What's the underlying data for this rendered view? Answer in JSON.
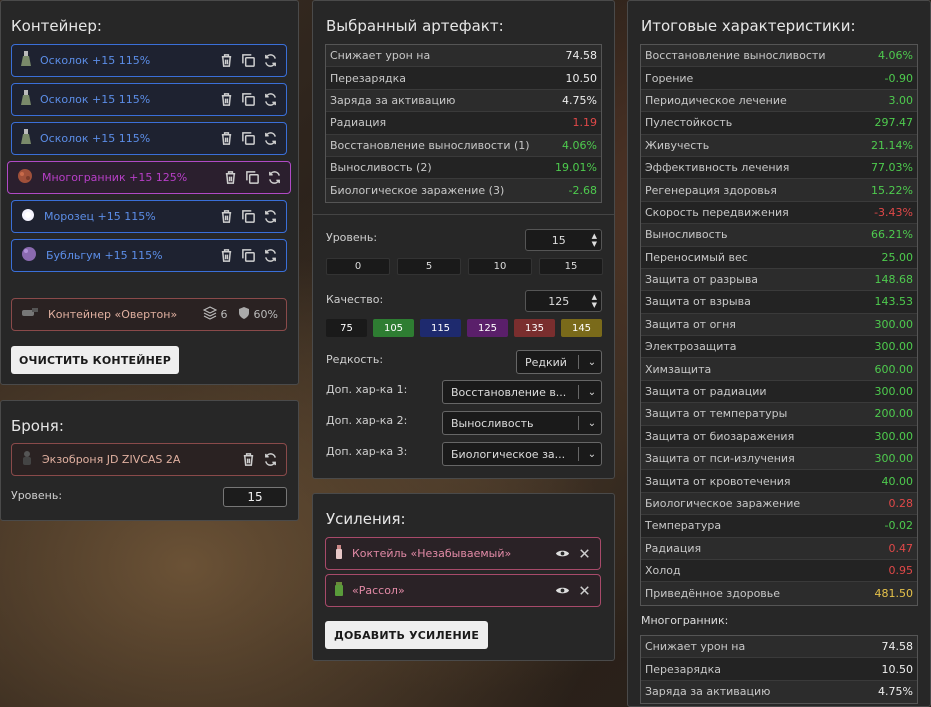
{
  "container": {
    "title": "Контейнер:",
    "items": [
      {
        "label": "Осколок +15 115%",
        "icon": "flask-icon"
      },
      {
        "label": "Осколок +15 115%",
        "icon": "flask-icon"
      },
      {
        "label": "Осколок +15 115%",
        "icon": "flask-icon"
      },
      {
        "label": "Многогранник +15 125%",
        "icon": "polyhedron-icon"
      },
      {
        "label": "Морозец +15 115%",
        "icon": "frost-icon"
      },
      {
        "label": "Бубльгум +15 115%",
        "icon": "bubblegum-icon"
      }
    ],
    "container_item": {
      "label": "Контейнер «Овертон»",
      "slots": "6",
      "protection": "60%"
    },
    "clear_button": "ОЧИСТИТЬ КОНТЕЙНЕР"
  },
  "armor": {
    "title": "Броня:",
    "item": "Экзоброня JD ZIVCAS 2A",
    "level_label": "Уровень:",
    "level_value": "15"
  },
  "artifact": {
    "title": "Выбранный артефакт:",
    "stats": [
      {
        "k": "Снижает урон на",
        "v": "74.58",
        "c": "white"
      },
      {
        "k": "Перезарядка",
        "v": "10.50",
        "c": "white"
      },
      {
        "k": "Заряда за активацию",
        "v": "4.75%",
        "c": "white"
      },
      {
        "k": "Радиация",
        "v": "1.19",
        "c": "red"
      },
      {
        "k": "Восстановление выносливости (1)",
        "v": "4.06%",
        "c": "green"
      },
      {
        "k": "Выносливость (2)",
        "v": "19.01%",
        "c": "green"
      },
      {
        "k": "Биологическое заражение (3)",
        "v": "-2.68",
        "c": "green"
      }
    ],
    "level_label": "Уровень:",
    "level_value": "15",
    "level_buttons": [
      "0",
      "5",
      "10",
      "15"
    ],
    "quality_label": "Качество:",
    "quality_value": "125",
    "quality_buttons": [
      {
        "label": "75",
        "color": "#1a1a1a"
      },
      {
        "label": "105",
        "color": "#2e7d32"
      },
      {
        "label": "115",
        "color": "#1e2a6e"
      },
      {
        "label": "125",
        "color": "#5a1f6a"
      },
      {
        "label": "135",
        "color": "#7a2e2e"
      },
      {
        "label": "145",
        "color": "#7a6a1a"
      }
    ],
    "rarity_label": "Редкость:",
    "rarity_value": "Редкий",
    "extra1_label": "Доп. хар-ка 1:",
    "extra1_value": "Восстановление в...",
    "extra2_label": "Доп. хар-ка 2:",
    "extra2_value": "Выносливость",
    "extra3_label": "Доп. хар-ка 3:",
    "extra3_value": "Биологическое за..."
  },
  "boosts": {
    "title": "Усиления:",
    "items": [
      {
        "label": "Коктейль «Незабываемый»"
      },
      {
        "label": "«Рассол»"
      }
    ],
    "add_button": "ДОБАВИТЬ УСИЛЕНИЕ"
  },
  "totals": {
    "title": "Итоговые характеристики:",
    "stats": [
      {
        "k": "Восстановление выносливости",
        "v": "4.06%",
        "c": "green"
      },
      {
        "k": "Горение",
        "v": "-0.90",
        "c": "green"
      },
      {
        "k": "Периодическое лечение",
        "v": "3.00",
        "c": "green"
      },
      {
        "k": "Пулестойкость",
        "v": "297.47",
        "c": "green"
      },
      {
        "k": "Живучесть",
        "v": "21.14%",
        "c": "green"
      },
      {
        "k": "Эффективность лечения",
        "v": "77.03%",
        "c": "green"
      },
      {
        "k": "Регенерация здоровья",
        "v": "15.22%",
        "c": "green"
      },
      {
        "k": "Скорость передвижения",
        "v": "-3.43%",
        "c": "red"
      },
      {
        "k": "Выносливость",
        "v": "66.21%",
        "c": "green"
      },
      {
        "k": "Переносимый вес",
        "v": "25.00",
        "c": "green"
      },
      {
        "k": "Защита от разрыва",
        "v": "148.68",
        "c": "green"
      },
      {
        "k": "Защита от взрыва",
        "v": "143.53",
        "c": "green"
      },
      {
        "k": "Защита от огня",
        "v": "300.00",
        "c": "green"
      },
      {
        "k": "Электрозащита",
        "v": "300.00",
        "c": "green"
      },
      {
        "k": "Химзащита",
        "v": "600.00",
        "c": "green"
      },
      {
        "k": "Защита от радиации",
        "v": "300.00",
        "c": "green"
      },
      {
        "k": "Защита от температуры",
        "v": "200.00",
        "c": "green"
      },
      {
        "k": "Защита от биозаражения",
        "v": "300.00",
        "c": "green"
      },
      {
        "k": "Защита от пси-излучения",
        "v": "300.00",
        "c": "green"
      },
      {
        "k": "Защита от кровотечения",
        "v": "40.00",
        "c": "green"
      },
      {
        "k": "Биологическое заражение",
        "v": "0.28",
        "c": "red"
      },
      {
        "k": "Температура",
        "v": "-0.02",
        "c": "green"
      },
      {
        "k": "Радиация",
        "v": "0.47",
        "c": "red"
      },
      {
        "k": "Холод",
        "v": "0.95",
        "c": "red"
      },
      {
        "k": "Приведённое здоровье",
        "v": "481.50",
        "c": "yellow"
      }
    ],
    "sub_title": "Многогранник:",
    "sub_stats": [
      {
        "k": "Снижает урон на",
        "v": "74.58",
        "c": "white"
      },
      {
        "k": "Перезарядка",
        "v": "10.50",
        "c": "white"
      },
      {
        "k": "Заряда за активацию",
        "v": "4.75%",
        "c": "white"
      }
    ]
  }
}
